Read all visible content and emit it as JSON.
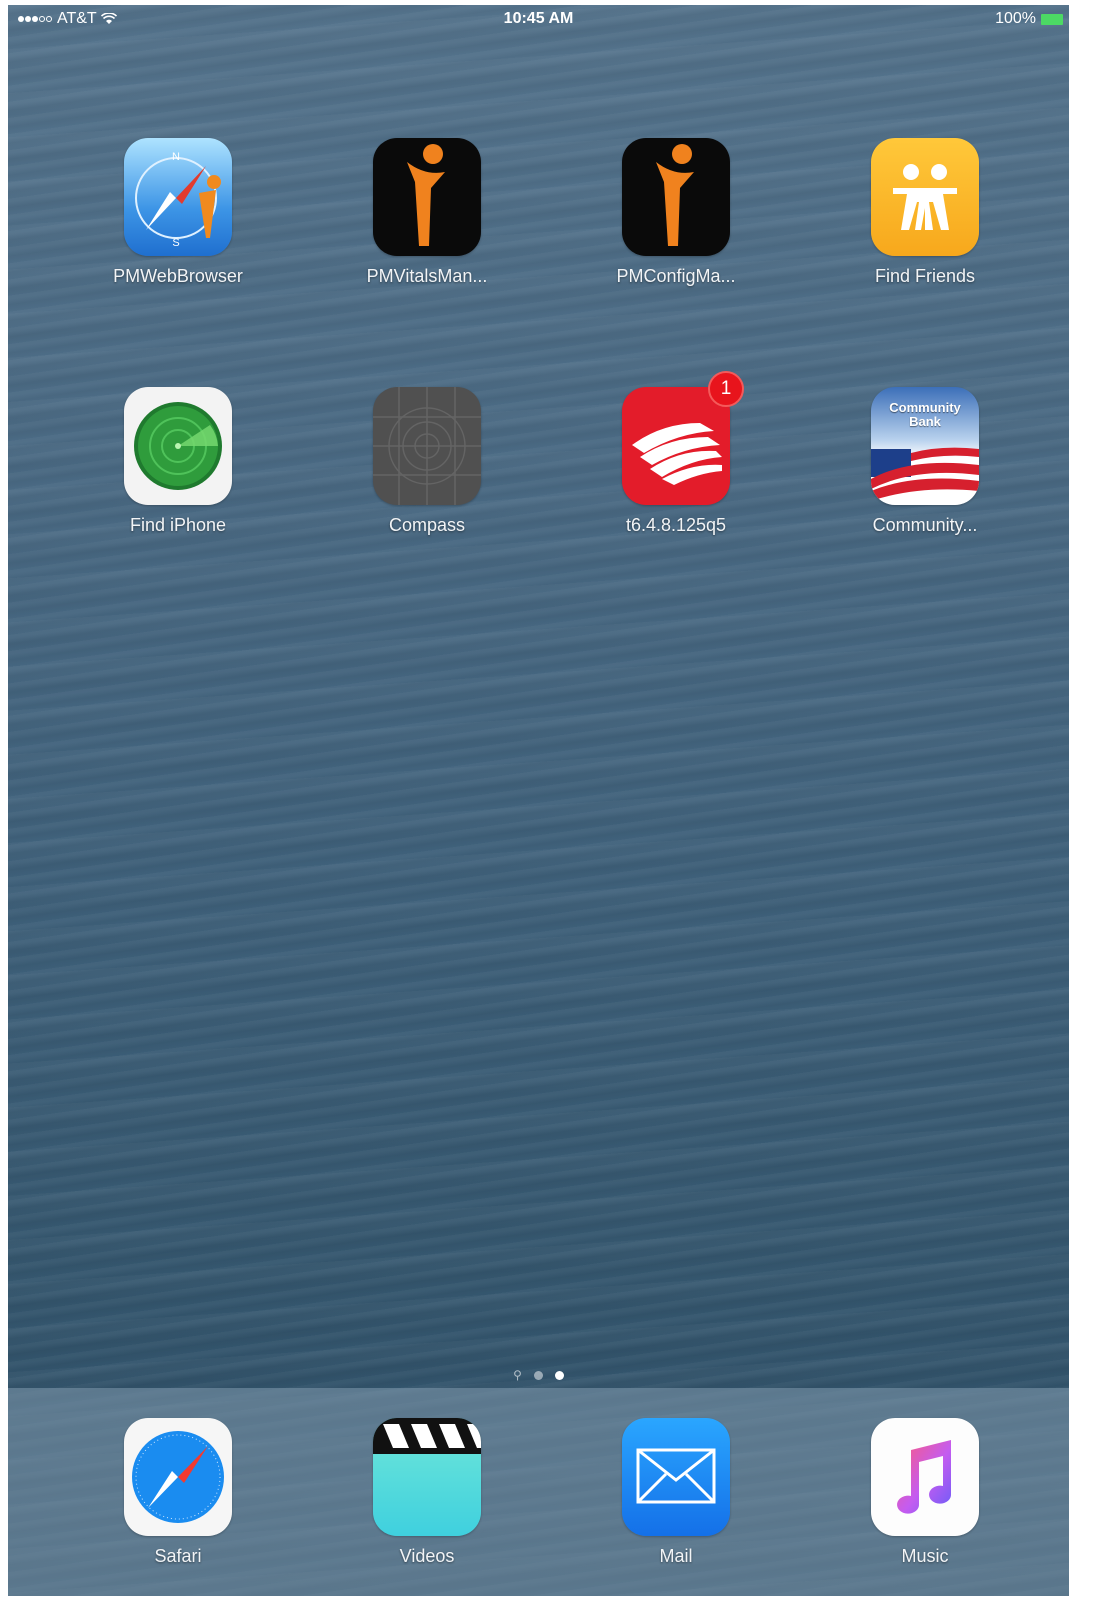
{
  "status_bar": {
    "carrier": "AT&T",
    "time": "10:45 AM",
    "battery": "100%",
    "signal_bars_filled": 3,
    "signal_bars_total": 5
  },
  "apps": [
    {
      "label": "PMWebBrowser",
      "icon": "compass-figure-icon"
    },
    {
      "label": "PMVitalsMan...",
      "icon": "orange-figure-icon"
    },
    {
      "label": "PMConfigMa...",
      "icon": "orange-figure-icon"
    },
    {
      "label": "Find Friends",
      "icon": "find-friends-icon"
    },
    {
      "label": "Find iPhone",
      "icon": "radar-icon"
    },
    {
      "label": "Compass",
      "icon": "compass-grid-icon"
    },
    {
      "label": "t6.4.8.125q5",
      "icon": "bank-flag-icon",
      "badge": "1"
    },
    {
      "label": "Community...",
      "icon": "community-bank-icon",
      "icon_text": "Community Bank"
    }
  ],
  "dock": [
    {
      "label": "Safari",
      "icon": "safari-compass-icon"
    },
    {
      "label": "Videos",
      "icon": "clapperboard-icon"
    },
    {
      "label": "Mail",
      "icon": "envelope-icon"
    },
    {
      "label": "Music",
      "icon": "music-note-icon"
    }
  ],
  "page_indicator": {
    "pages": 2,
    "current": 2,
    "has_search_page": true
  },
  "colors": {
    "badge": "#e8141c",
    "battery": "#4cd964",
    "find_friends": "#f7a81c",
    "bank_red": "#e31c2a",
    "mail_blue": "#1a8cf0",
    "videos_teal": "#4fd8d0"
  }
}
